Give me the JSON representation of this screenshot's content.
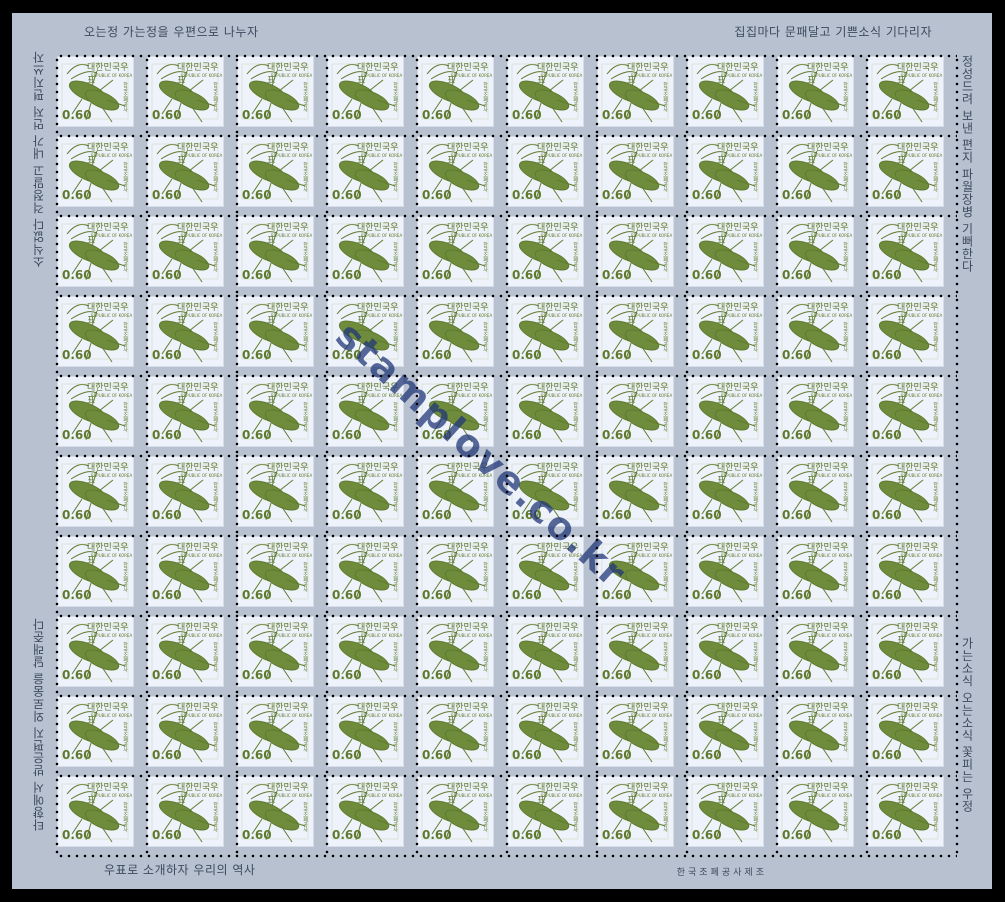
{
  "sheet": {
    "top_left_text": "오는정 가는정을 우편으로 나누자",
    "top_right_text": "집집마다 문패달고 기쁜소식 기다리자",
    "bottom_left_text": "우표로 소개하자 우리의 역사",
    "bottom_right_text": "한국조폐공사제조",
    "left_upper_vertical": "소식없다 걱정말고 내가 먼저 편지쓰자",
    "left_lower_vertical": "타향에서 받은편지 외로움을 달래준다",
    "right_upper_vertical": "정성드려 보낸 편지 파월장병 기뻐한다",
    "right_lower_vertical": "가는소식 오는소식 꽃피는 우정",
    "watermark": "stamplove.co.kr"
  },
  "stamp": {
    "country_ko": "대한민국우표",
    "country_en": "REPUBLIC OF KOREA",
    "value": "0.60",
    "imprint": "한국조폐공사",
    "ink_color": "#5e7a2d",
    "icon": "longhorn-beetle-icon"
  },
  "grid": {
    "rows": 10,
    "cols": 10
  }
}
